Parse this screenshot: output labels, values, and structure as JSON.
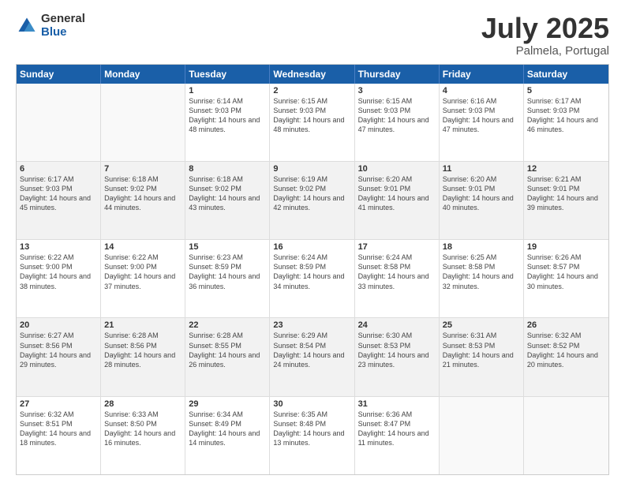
{
  "logo": {
    "general": "General",
    "blue": "Blue"
  },
  "title": {
    "month": "July 2025",
    "location": "Palmela, Portugal"
  },
  "header_days": [
    "Sunday",
    "Monday",
    "Tuesday",
    "Wednesday",
    "Thursday",
    "Friday",
    "Saturday"
  ],
  "weeks": [
    [
      {
        "day": "",
        "info": ""
      },
      {
        "day": "",
        "info": ""
      },
      {
        "day": "1",
        "info": "Sunrise: 6:14 AM\nSunset: 9:03 PM\nDaylight: 14 hours and 48 minutes."
      },
      {
        "day": "2",
        "info": "Sunrise: 6:15 AM\nSunset: 9:03 PM\nDaylight: 14 hours and 48 minutes."
      },
      {
        "day": "3",
        "info": "Sunrise: 6:15 AM\nSunset: 9:03 PM\nDaylight: 14 hours and 47 minutes."
      },
      {
        "day": "4",
        "info": "Sunrise: 6:16 AM\nSunset: 9:03 PM\nDaylight: 14 hours and 47 minutes."
      },
      {
        "day": "5",
        "info": "Sunrise: 6:17 AM\nSunset: 9:03 PM\nDaylight: 14 hours and 46 minutes."
      }
    ],
    [
      {
        "day": "6",
        "info": "Sunrise: 6:17 AM\nSunset: 9:03 PM\nDaylight: 14 hours and 45 minutes."
      },
      {
        "day": "7",
        "info": "Sunrise: 6:18 AM\nSunset: 9:02 PM\nDaylight: 14 hours and 44 minutes."
      },
      {
        "day": "8",
        "info": "Sunrise: 6:18 AM\nSunset: 9:02 PM\nDaylight: 14 hours and 43 minutes."
      },
      {
        "day": "9",
        "info": "Sunrise: 6:19 AM\nSunset: 9:02 PM\nDaylight: 14 hours and 42 minutes."
      },
      {
        "day": "10",
        "info": "Sunrise: 6:20 AM\nSunset: 9:01 PM\nDaylight: 14 hours and 41 minutes."
      },
      {
        "day": "11",
        "info": "Sunrise: 6:20 AM\nSunset: 9:01 PM\nDaylight: 14 hours and 40 minutes."
      },
      {
        "day": "12",
        "info": "Sunrise: 6:21 AM\nSunset: 9:01 PM\nDaylight: 14 hours and 39 minutes."
      }
    ],
    [
      {
        "day": "13",
        "info": "Sunrise: 6:22 AM\nSunset: 9:00 PM\nDaylight: 14 hours and 38 minutes."
      },
      {
        "day": "14",
        "info": "Sunrise: 6:22 AM\nSunset: 9:00 PM\nDaylight: 14 hours and 37 minutes."
      },
      {
        "day": "15",
        "info": "Sunrise: 6:23 AM\nSunset: 8:59 PM\nDaylight: 14 hours and 36 minutes."
      },
      {
        "day": "16",
        "info": "Sunrise: 6:24 AM\nSunset: 8:59 PM\nDaylight: 14 hours and 34 minutes."
      },
      {
        "day": "17",
        "info": "Sunrise: 6:24 AM\nSunset: 8:58 PM\nDaylight: 14 hours and 33 minutes."
      },
      {
        "day": "18",
        "info": "Sunrise: 6:25 AM\nSunset: 8:58 PM\nDaylight: 14 hours and 32 minutes."
      },
      {
        "day": "19",
        "info": "Sunrise: 6:26 AM\nSunset: 8:57 PM\nDaylight: 14 hours and 30 minutes."
      }
    ],
    [
      {
        "day": "20",
        "info": "Sunrise: 6:27 AM\nSunset: 8:56 PM\nDaylight: 14 hours and 29 minutes."
      },
      {
        "day": "21",
        "info": "Sunrise: 6:28 AM\nSunset: 8:56 PM\nDaylight: 14 hours and 28 minutes."
      },
      {
        "day": "22",
        "info": "Sunrise: 6:28 AM\nSunset: 8:55 PM\nDaylight: 14 hours and 26 minutes."
      },
      {
        "day": "23",
        "info": "Sunrise: 6:29 AM\nSunset: 8:54 PM\nDaylight: 14 hours and 24 minutes."
      },
      {
        "day": "24",
        "info": "Sunrise: 6:30 AM\nSunset: 8:53 PM\nDaylight: 14 hours and 23 minutes."
      },
      {
        "day": "25",
        "info": "Sunrise: 6:31 AM\nSunset: 8:53 PM\nDaylight: 14 hours and 21 minutes."
      },
      {
        "day": "26",
        "info": "Sunrise: 6:32 AM\nSunset: 8:52 PM\nDaylight: 14 hours and 20 minutes."
      }
    ],
    [
      {
        "day": "27",
        "info": "Sunrise: 6:32 AM\nSunset: 8:51 PM\nDaylight: 14 hours and 18 minutes."
      },
      {
        "day": "28",
        "info": "Sunrise: 6:33 AM\nSunset: 8:50 PM\nDaylight: 14 hours and 16 minutes."
      },
      {
        "day": "29",
        "info": "Sunrise: 6:34 AM\nSunset: 8:49 PM\nDaylight: 14 hours and 14 minutes."
      },
      {
        "day": "30",
        "info": "Sunrise: 6:35 AM\nSunset: 8:48 PM\nDaylight: 14 hours and 13 minutes."
      },
      {
        "day": "31",
        "info": "Sunrise: 6:36 AM\nSunset: 8:47 PM\nDaylight: 14 hours and 11 minutes."
      },
      {
        "day": "",
        "info": ""
      },
      {
        "day": "",
        "info": ""
      }
    ]
  ]
}
